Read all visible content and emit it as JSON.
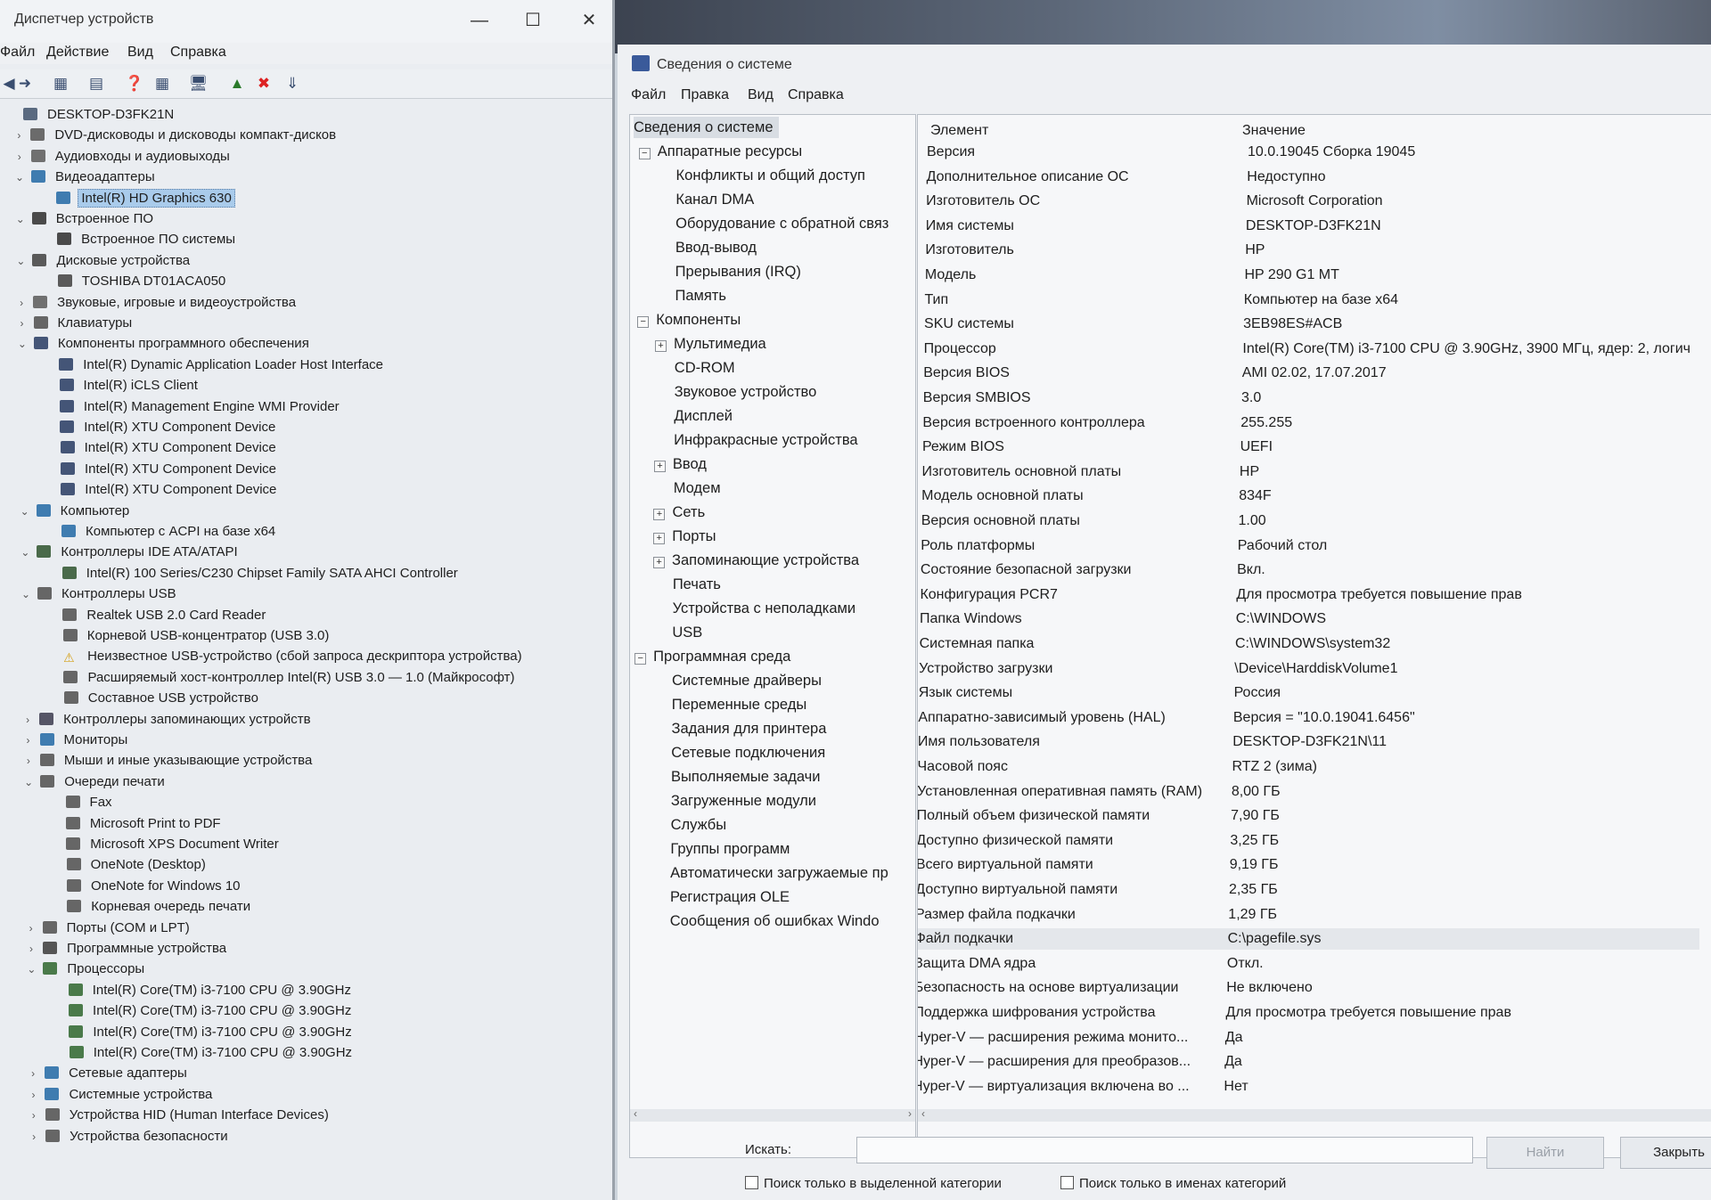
{
  "device_manager": {
    "title": "Диспетчер устройств",
    "menu": [
      "Файл",
      "Действие",
      "Вид",
      "Справка"
    ],
    "tree": [
      {
        "label": "DESKTOP-D3FK21N",
        "level": 0,
        "exp": "",
        "icon": "computer-icon",
        "color": "#5a6a80"
      },
      {
        "label": "DVD-дисководы и дисководы компакт-дисков",
        "level": 1,
        "exp": "›",
        "icon": "dvd-icon",
        "color": "#6b6b6b"
      },
      {
        "label": "Аудиовходы и аудиовыходы",
        "level": 1,
        "exp": "›",
        "icon": "speaker-icon",
        "color": "#707070"
      },
      {
        "label": "Видеоадаптеры",
        "level": 1,
        "exp": "⌄",
        "icon": "display-adapter-icon",
        "color": "#3f7cb0"
      },
      {
        "label": "Intel(R) HD Graphics 630",
        "level": 2,
        "exp": "",
        "icon": "display-adapter-icon",
        "color": "#3f7cb0",
        "selected": true
      },
      {
        "label": "Встроенное ПО",
        "level": 1,
        "exp": "⌄",
        "icon": "firmware-icon",
        "color": "#4a4a4a"
      },
      {
        "label": "Встроенное ПО системы",
        "level": 2,
        "exp": "",
        "icon": "firmware-icon",
        "color": "#4a4a4a"
      },
      {
        "label": "Дисковые устройства",
        "level": 1,
        "exp": "⌄",
        "icon": "disk-icon",
        "color": "#5a5a5a"
      },
      {
        "label": "TOSHIBA DT01ACA050",
        "level": 2,
        "exp": "",
        "icon": "disk-icon",
        "color": "#5a5a5a"
      },
      {
        "label": "Звуковые, игровые и видеоустройства",
        "level": 1,
        "exp": "›",
        "icon": "sound-icon",
        "color": "#707070"
      },
      {
        "label": "Клавиатуры",
        "level": 1,
        "exp": "›",
        "icon": "keyboard-icon",
        "color": "#666"
      },
      {
        "label": "Компоненты программного обеспечения",
        "level": 1,
        "exp": "⌄",
        "icon": "software-component-icon",
        "color": "#445577"
      },
      {
        "label": "Intel(R) Dynamic Application Loader Host Interface",
        "level": 2,
        "exp": "",
        "icon": "software-component-icon",
        "color": "#445577"
      },
      {
        "label": "Intel(R) iCLS Client",
        "level": 2,
        "exp": "",
        "icon": "software-component-icon",
        "color": "#445577"
      },
      {
        "label": "Intel(R) Management Engine WMI Provider",
        "level": 2,
        "exp": "",
        "icon": "software-component-icon",
        "color": "#445577"
      },
      {
        "label": "Intel(R) XTU Component Device",
        "level": 2,
        "exp": "",
        "icon": "software-component-icon",
        "color": "#445577"
      },
      {
        "label": "Intel(R) XTU Component Device",
        "level": 2,
        "exp": "",
        "icon": "software-component-icon",
        "color": "#445577"
      },
      {
        "label": "Intel(R) XTU Component Device",
        "level": 2,
        "exp": "",
        "icon": "software-component-icon",
        "color": "#445577"
      },
      {
        "label": "Intel(R) XTU Component Device",
        "level": 2,
        "exp": "",
        "icon": "software-component-icon",
        "color": "#445577"
      },
      {
        "label": "Компьютер",
        "level": 1,
        "exp": "⌄",
        "icon": "computer-icon",
        "color": "#3f7cb0"
      },
      {
        "label": "Компьютер с ACPI на базе x64",
        "level": 2,
        "exp": "",
        "icon": "computer-icon",
        "color": "#3f7cb0"
      },
      {
        "label": "Контроллеры IDE ATA/ATAPI",
        "level": 1,
        "exp": "⌄",
        "icon": "ide-controller-icon",
        "color": "#4a6a4a"
      },
      {
        "label": "Intel(R) 100 Series/C230 Chipset Family SATA AHCI Controller",
        "level": 2,
        "exp": "",
        "icon": "ide-controller-icon",
        "color": "#4a6a4a"
      },
      {
        "label": "Контроллеры USB",
        "level": 1,
        "exp": "⌄",
        "icon": "usb-icon",
        "color": "#666"
      },
      {
        "label": "Realtek USB 2.0 Card Reader",
        "level": 2,
        "exp": "",
        "icon": "usb-icon",
        "color": "#666"
      },
      {
        "label": "Корневой USB-концентратор (USB 3.0)",
        "level": 2,
        "exp": "",
        "icon": "usb-icon",
        "color": "#666"
      },
      {
        "label": "Неизвестное USB-устройство (сбой запроса дескриптора устройства)",
        "level": 2,
        "exp": "",
        "icon": "warning-icon",
        "color": "#d4a017"
      },
      {
        "label": "Расширяемый хост-контроллер Intel(R) USB 3.0 — 1.0 (Майкрософт)",
        "level": 2,
        "exp": "",
        "icon": "usb-icon",
        "color": "#666"
      },
      {
        "label": "Составное USB устройство",
        "level": 2,
        "exp": "",
        "icon": "usb-icon",
        "color": "#666"
      },
      {
        "label": "Контроллеры запоминающих устройств",
        "level": 1,
        "exp": "›",
        "icon": "storage-controller-icon",
        "color": "#556"
      },
      {
        "label": "Мониторы",
        "level": 1,
        "exp": "›",
        "icon": "monitor-icon",
        "color": "#3f7cb0"
      },
      {
        "label": "Мыши и иные указывающие устройства",
        "level": 1,
        "exp": "›",
        "icon": "mouse-icon",
        "color": "#666"
      },
      {
        "label": "Очереди печати",
        "level": 1,
        "exp": "⌄",
        "icon": "printer-icon",
        "color": "#666"
      },
      {
        "label": "Fax",
        "level": 2,
        "exp": "",
        "icon": "printer-icon",
        "color": "#666"
      },
      {
        "label": "Microsoft Print to PDF",
        "level": 2,
        "exp": "",
        "icon": "printer-icon",
        "color": "#666"
      },
      {
        "label": "Microsoft XPS Document Writer",
        "level": 2,
        "exp": "",
        "icon": "printer-icon",
        "color": "#666"
      },
      {
        "label": "OneNote (Desktop)",
        "level": 2,
        "exp": "",
        "icon": "printer-icon",
        "color": "#666"
      },
      {
        "label": "OneNote for Windows 10",
        "level": 2,
        "exp": "",
        "icon": "printer-icon",
        "color": "#666"
      },
      {
        "label": "Корневая очередь печати",
        "level": 2,
        "exp": "",
        "icon": "printer-icon",
        "color": "#666"
      },
      {
        "label": "Порты (COM и LPT)",
        "level": 1,
        "exp": "›",
        "icon": "port-icon",
        "color": "#666"
      },
      {
        "label": "Программные устройства",
        "level": 1,
        "exp": "›",
        "icon": "software-device-icon",
        "color": "#555"
      },
      {
        "label": "Процессоры",
        "level": 1,
        "exp": "⌄",
        "icon": "processor-icon",
        "color": "#4a7a4a"
      },
      {
        "label": "Intel(R) Core(TM) i3-7100 CPU @ 3.90GHz",
        "level": 2,
        "exp": "",
        "icon": "processor-icon",
        "color": "#4a7a4a"
      },
      {
        "label": "Intel(R) Core(TM) i3-7100 CPU @ 3.90GHz",
        "level": 2,
        "exp": "",
        "icon": "processor-icon",
        "color": "#4a7a4a"
      },
      {
        "label": "Intel(R) Core(TM) i3-7100 CPU @ 3.90GHz",
        "level": 2,
        "exp": "",
        "icon": "processor-icon",
        "color": "#4a7a4a"
      },
      {
        "label": "Intel(R) Core(TM) i3-7100 CPU @ 3.90GHz",
        "level": 2,
        "exp": "",
        "icon": "processor-icon",
        "color": "#4a7a4a"
      },
      {
        "label": "Сетевые адаптеры",
        "level": 1,
        "exp": "›",
        "icon": "network-icon",
        "color": "#3f7cb0"
      },
      {
        "label": "Системные устройства",
        "level": 1,
        "exp": "›",
        "icon": "system-device-icon",
        "color": "#3f7cb0"
      },
      {
        "label": "Устройства HID (Human Interface Devices)",
        "level": 1,
        "exp": "›",
        "icon": "hid-icon",
        "color": "#666"
      },
      {
        "label": "Устройства безопасности",
        "level": 1,
        "exp": "›",
        "icon": "security-device-icon",
        "color": "#666"
      }
    ]
  },
  "system_info": {
    "title": "Сведения о системе",
    "menu": [
      "Файл",
      "Правка",
      "Вид",
      "Справка"
    ],
    "tree": [
      {
        "label": "Сведения о системе",
        "level": 0,
        "box": ""
      },
      {
        "label": "Аппаратные ресурсы",
        "level": 1,
        "box": "−"
      },
      {
        "label": "Конфликты и общий доступ",
        "level": 2,
        "box": ""
      },
      {
        "label": "Канал DMA",
        "level": 2,
        "box": ""
      },
      {
        "label": "Оборудование с обратной связ",
        "level": 2,
        "box": ""
      },
      {
        "label": "Ввод-вывод",
        "level": 2,
        "box": ""
      },
      {
        "label": "Прерывания (IRQ)",
        "level": 2,
        "box": ""
      },
      {
        "label": "Память",
        "level": 2,
        "box": ""
      },
      {
        "label": "Компоненты",
        "level": 1,
        "box": "−"
      },
      {
        "label": "Мультимедиа",
        "level": 2,
        "box": "+"
      },
      {
        "label": "CD-ROM",
        "level": 2,
        "box": ""
      },
      {
        "label": "Звуковое устройство",
        "level": 2,
        "box": ""
      },
      {
        "label": "Дисплей",
        "level": 2,
        "box": ""
      },
      {
        "label": "Инфракрасные устройства",
        "level": 2,
        "box": ""
      },
      {
        "label": "Ввод",
        "level": 2,
        "box": "+"
      },
      {
        "label": "Модем",
        "level": 2,
        "box": ""
      },
      {
        "label": "Сеть",
        "level": 2,
        "box": "+"
      },
      {
        "label": "Порты",
        "level": 2,
        "box": "+"
      },
      {
        "label": "Запоминающие устройства",
        "level": 2,
        "box": "+"
      },
      {
        "label": "Печать",
        "level": 2,
        "box": ""
      },
      {
        "label": "Устройства с неполадками",
        "level": 2,
        "box": ""
      },
      {
        "label": "USB",
        "level": 2,
        "box": ""
      },
      {
        "label": "Программная среда",
        "level": 1,
        "box": "−"
      },
      {
        "label": "Системные драйверы",
        "level": 2,
        "box": ""
      },
      {
        "label": "Переменные среды",
        "level": 2,
        "box": ""
      },
      {
        "label": "Задания для принтера",
        "level": 2,
        "box": ""
      },
      {
        "label": "Сетевые подключения",
        "level": 2,
        "box": ""
      },
      {
        "label": "Выполняемые задачи",
        "level": 2,
        "box": ""
      },
      {
        "label": "Загруженные модули",
        "level": 2,
        "box": ""
      },
      {
        "label": "Службы",
        "level": 2,
        "box": ""
      },
      {
        "label": "Группы программ",
        "level": 2,
        "box": ""
      },
      {
        "label": "Автоматически загружаемые пр",
        "level": 2,
        "box": ""
      },
      {
        "label": "Регистрация OLE",
        "level": 2,
        "box": ""
      },
      {
        "label": "Сообщения об ошибках Windo",
        "level": 2,
        "box": ""
      }
    ],
    "columns": {
      "item": "Элемент",
      "value": "Значение"
    },
    "rows": [
      [
        "Версия",
        "10.0.19045 Сборка 19045"
      ],
      [
        "Дополнительное описание ОС",
        "Недоступно"
      ],
      [
        "Изготовитель ОС",
        "Microsoft Corporation"
      ],
      [
        "Имя системы",
        "DESKTOP-D3FK21N"
      ],
      [
        "Изготовитель",
        "HP"
      ],
      [
        "Модель",
        "HP 290 G1 MT"
      ],
      [
        "Тип",
        "Компьютер на базе x64"
      ],
      [
        "SKU системы",
        "3EB98ES#ACB"
      ],
      [
        "Процессор",
        "Intel(R) Core(TM) i3-7100 CPU @ 3.90GHz, 3900 МГц, ядер: 2, логич"
      ],
      [
        "Версия BIOS",
        "AMI 02.02, 17.07.2017"
      ],
      [
        "Версия SMBIOS",
        "3.0"
      ],
      [
        "Версия встроенного контроллера",
        "255.255"
      ],
      [
        "Режим BIOS",
        "UEFI"
      ],
      [
        "Изготовитель основной платы",
        "HP"
      ],
      [
        "Модель основной платы",
        "834F"
      ],
      [
        "Версия основной платы",
        "1.00"
      ],
      [
        "Роль платформы",
        "Рабочий стол"
      ],
      [
        "Состояние безопасной загрузки",
        "Вкл."
      ],
      [
        "Конфигурация PCR7",
        "Для просмотра требуется повышение прав"
      ],
      [
        "Папка Windows",
        "C:\\WINDOWS"
      ],
      [
        "Системная папка",
        "C:\\WINDOWS\\system32"
      ],
      [
        "Устройство загрузки",
        "\\Device\\HarddiskVolume1"
      ],
      [
        "Язык системы",
        "Россия"
      ],
      [
        "Аппаратно-зависимый уровень (HAL)",
        "Версия = \"10.0.19041.6456\""
      ],
      [
        "Имя пользователя",
        "DESKTOP-D3FK21N\\11"
      ],
      [
        "Часовой пояс",
        "RTZ 2 (зима)"
      ],
      [
        "Установленная оперативная память (RAM)",
        "8,00 ГБ"
      ],
      [
        "Полный объем физической памяти",
        "7,90 ГБ"
      ],
      [
        "Доступно физической памяти",
        "3,25 ГБ"
      ],
      [
        "Всего виртуальной памяти",
        "9,19 ГБ"
      ],
      [
        "Доступно виртуальной памяти",
        "2,35 ГБ"
      ],
      [
        "Размер файла подкачки",
        "1,29 ГБ"
      ],
      [
        "Файл подкачки",
        "C:\\pagefile.sys"
      ],
      [
        "Защита DMA ядра",
        "Откл."
      ],
      [
        "Безопасность на основе виртуализации",
        "Не включено"
      ],
      [
        "Поддержка шифрования устройства",
        "Для просмотра требуется повышение прав"
      ],
      [
        "Hyper-V — расширения режима монито...",
        "Да"
      ],
      [
        "Hyper-V — расширения для преобразов...",
        "Да"
      ],
      [
        "Hyper-V — виртуализация включена во ...",
        "Нет"
      ]
    ],
    "search": {
      "label": "Искать:",
      "value": "",
      "find_label": "Найти",
      "close_label": "Закрыть",
      "check_selected": "Поиск только в выделенной категории",
      "check_names": "Поиск только в именах категорий"
    }
  }
}
